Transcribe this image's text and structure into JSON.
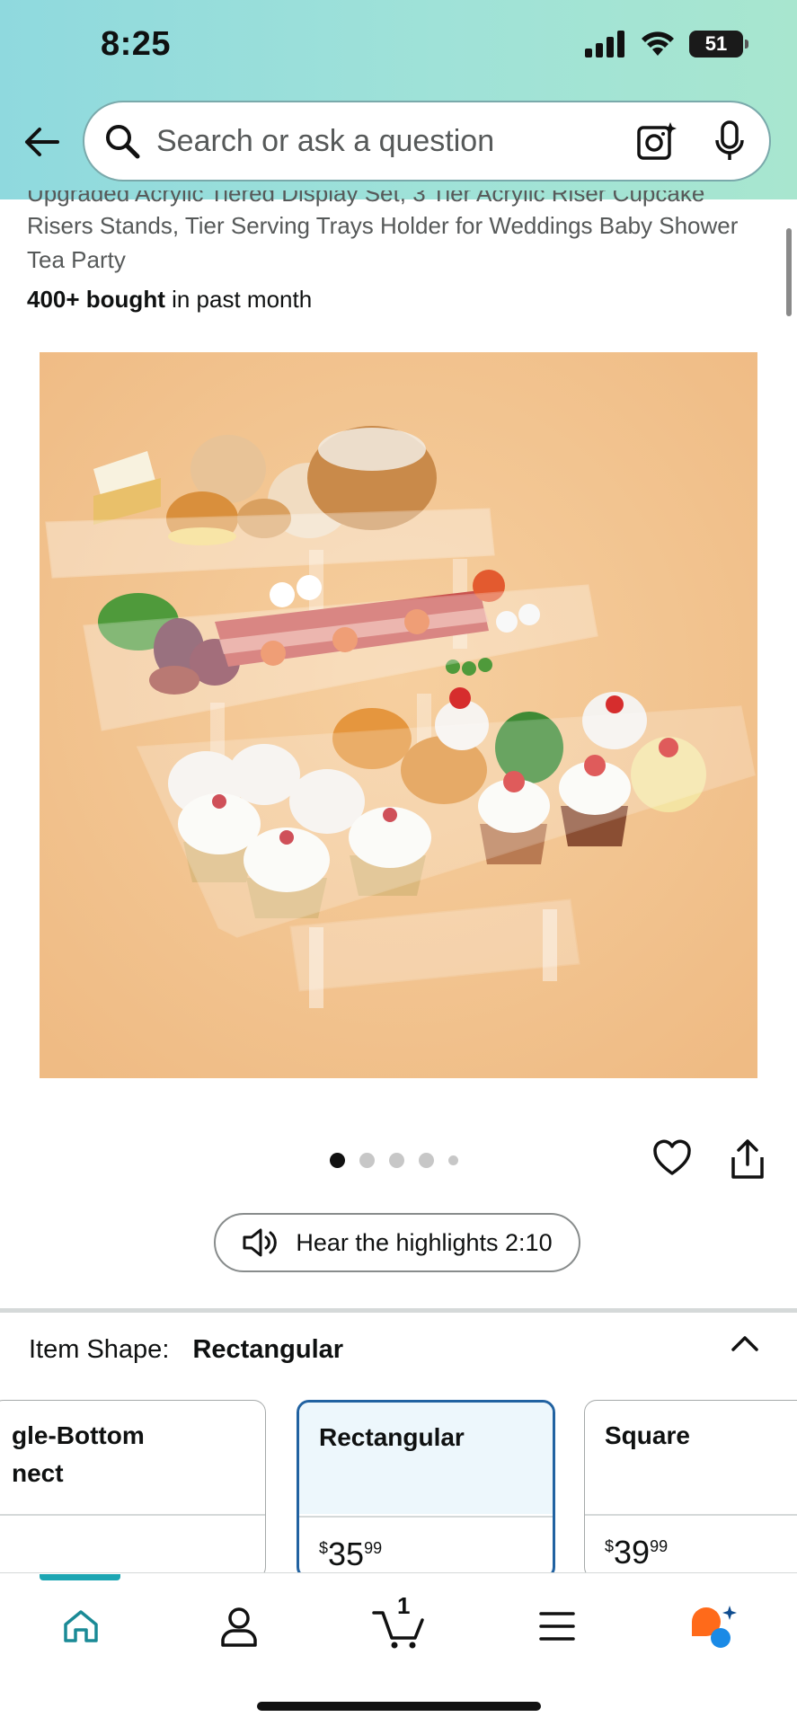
{
  "status_bar": {
    "time": "8:25",
    "battery": "51"
  },
  "search": {
    "placeholder": "Search or ask a question"
  },
  "product": {
    "title_cut": "Upgraded Acrylic Tiered Display Set, 3 Tier Acrylic Riser Cupcake",
    "title_line1": "Risers Stands, Tier Serving Trays Holder for Weddings Baby Shower",
    "title_line2": "Tea Party",
    "bought_bold": "400+ bought",
    "bought_rest": " in past month"
  },
  "image_carousel": {
    "total": 5,
    "active_index": 0
  },
  "hear_button": {
    "label": "Hear the highlights 2:10"
  },
  "item_shape": {
    "label": "Item Shape:",
    "value": "Rectangular"
  },
  "options": [
    {
      "title_line1": "gle-Bottom",
      "title_line2": "nect",
      "price_whole": "",
      "price_frac": ""
    },
    {
      "title_line1": "Rectangular",
      "title_line2": "",
      "price_whole": "35",
      "price_frac": "99",
      "currency": "$"
    },
    {
      "title_line1": "Square",
      "title_line2": "",
      "price_whole": "39",
      "price_frac": "99",
      "currency": "$"
    }
  ],
  "bottom_nav": {
    "cart_count": "1",
    "active": "home"
  },
  "colors": {
    "accent": "#2162a1",
    "teal": "#1da6b3",
    "image_bg": "#f3c596"
  }
}
